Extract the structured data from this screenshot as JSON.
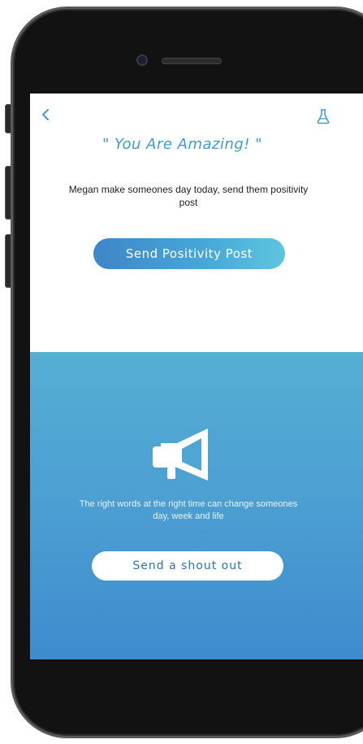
{
  "header": {
    "back_icon": "chevron-left-icon",
    "flask_icon": "flask-icon"
  },
  "main": {
    "quote": "\" You Are Amazing! \"",
    "subtext": "Megan make someones day today, send them positivity post",
    "primary_button_label": "Send Positivity Post"
  },
  "shoutout": {
    "icon": "megaphone-icon",
    "tagline": "The right words at the right time can change someones day, week and life",
    "button_label": "Send a shout out"
  },
  "colors": {
    "accent": "#3f9ad4",
    "gradient_start": "#55afd3",
    "gradient_end": "#3f8bcd",
    "button_text": "#2a74b8"
  }
}
